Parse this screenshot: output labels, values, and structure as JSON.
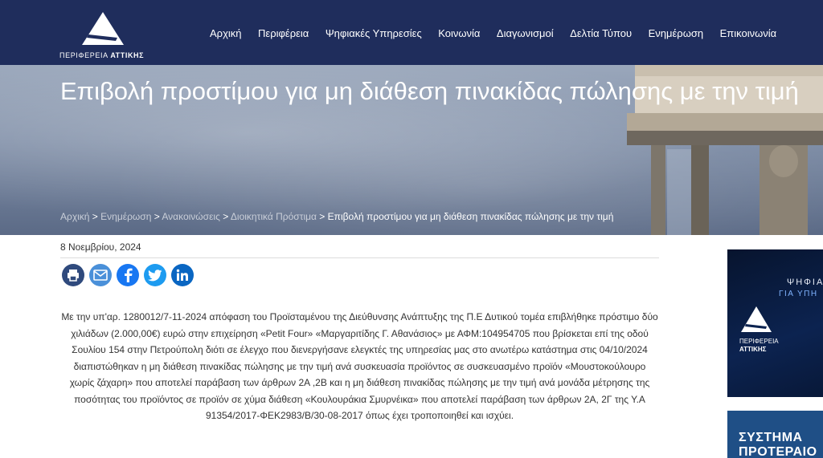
{
  "header": {
    "logo_text_regular": "ΠΕΡΙΦΕΡΕΙΑ ",
    "logo_text_bold": "ΑΤΤΙΚΗΣ",
    "nav": [
      {
        "label": "Αρχική"
      },
      {
        "label": "Περιφέρεια"
      },
      {
        "label": "Ψηφιακές Υπηρεσίες"
      },
      {
        "label": "Κοινωνία"
      },
      {
        "label": "Διαγωνισμοί"
      },
      {
        "label": "Δελτία Τύπου"
      },
      {
        "label": "Ενημέρωση"
      },
      {
        "label": "Επικοινωνία"
      }
    ]
  },
  "hero": {
    "title": "Επιβολή προστίμου για μη διάθεση πινακίδας πώλησης με την τιμή",
    "breadcrumb": [
      {
        "label": "Αρχική"
      },
      {
        "label": "Ενημέρωση"
      },
      {
        "label": "Ανακοινώσεις"
      },
      {
        "label": "Διοικητικά Πρόστιμα"
      }
    ],
    "separator": " > ",
    "current": "Επιβολή προστίμου για μη διάθεση πινακίδας πώλησης με την τιμή"
  },
  "article": {
    "date": "8 Νοεμβρίου, 2024",
    "share_icons": [
      "print-icon",
      "email-icon",
      "facebook-icon",
      "twitter-icon",
      "linkedin-icon"
    ],
    "body": "Με την υπ'αρ. 1280012/7-11-2024 απόφαση του Προϊσταμένου της Διεύθυνσης Ανάπτυξης της Π.Ε Δυτικού τομέα επιβλήθηκε πρόστιμο δύο χιλιάδων (2.000,00€) ευρώ στην επιχείρηση «Petit Four» «Μαργαριτίδης Γ. Αθανάσιος» με ΑΦΜ:104954705 που βρίσκεται επί της οδού Σουλίου 154 στην Πετρούπολη διότι σε έλεγχο που διενεργήσανε ελεγκτές της υπηρεσίας μας στο ανωτέρω κατάστημα στις 04/10/2024 διαπιστώθηκαν η μη διάθεση πινακίδας πώλησης με την τιμή ανά συσκευασία προϊόντος σε συσκευασμένο προϊόν «Μουστοκούλουρο χωρίς ζάχαρη» που αποτελεί παράβαση των άρθρων 2Α ,2Β  και η μη διάθεση πινακίδας πώλησης με την τιμή ανά μονάδα μέτρησης της ποσότητας του προϊόντος σε προϊόν σε χύμα διάθεση «Κουλουράκια Σμυρνέικα» που αποτελεί παράβαση των άρθρων  2Α, 2Γ της Υ.Α 91354/2017-ΦΕΚ2983/Β/30-08-2017 όπως έχει τροποποιηθεί και ισχύει."
  },
  "sidebar": {
    "ad1_line1": "ΨΗΦΙΑ",
    "ad1_line2": "ΓΙΑ ΥΠΗ",
    "ad1_logo_line1": "ΠΕΡΙΦΕΡΕΙΑ",
    "ad1_logo_line2": "ΑΤΤΙΚΗΣ",
    "ad2_line1": "ΣΥΣΤΗΜΑ",
    "ad2_line2": "ΠΡΟΤΕΡΑΙΟ"
  },
  "colors": {
    "header_bg": "#1f2d5c",
    "print": "#2f4a7d",
    "email": "#4a90d9",
    "facebook": "#1877f2",
    "twitter": "#1d9bf0",
    "linkedin": "#0a66c2"
  }
}
